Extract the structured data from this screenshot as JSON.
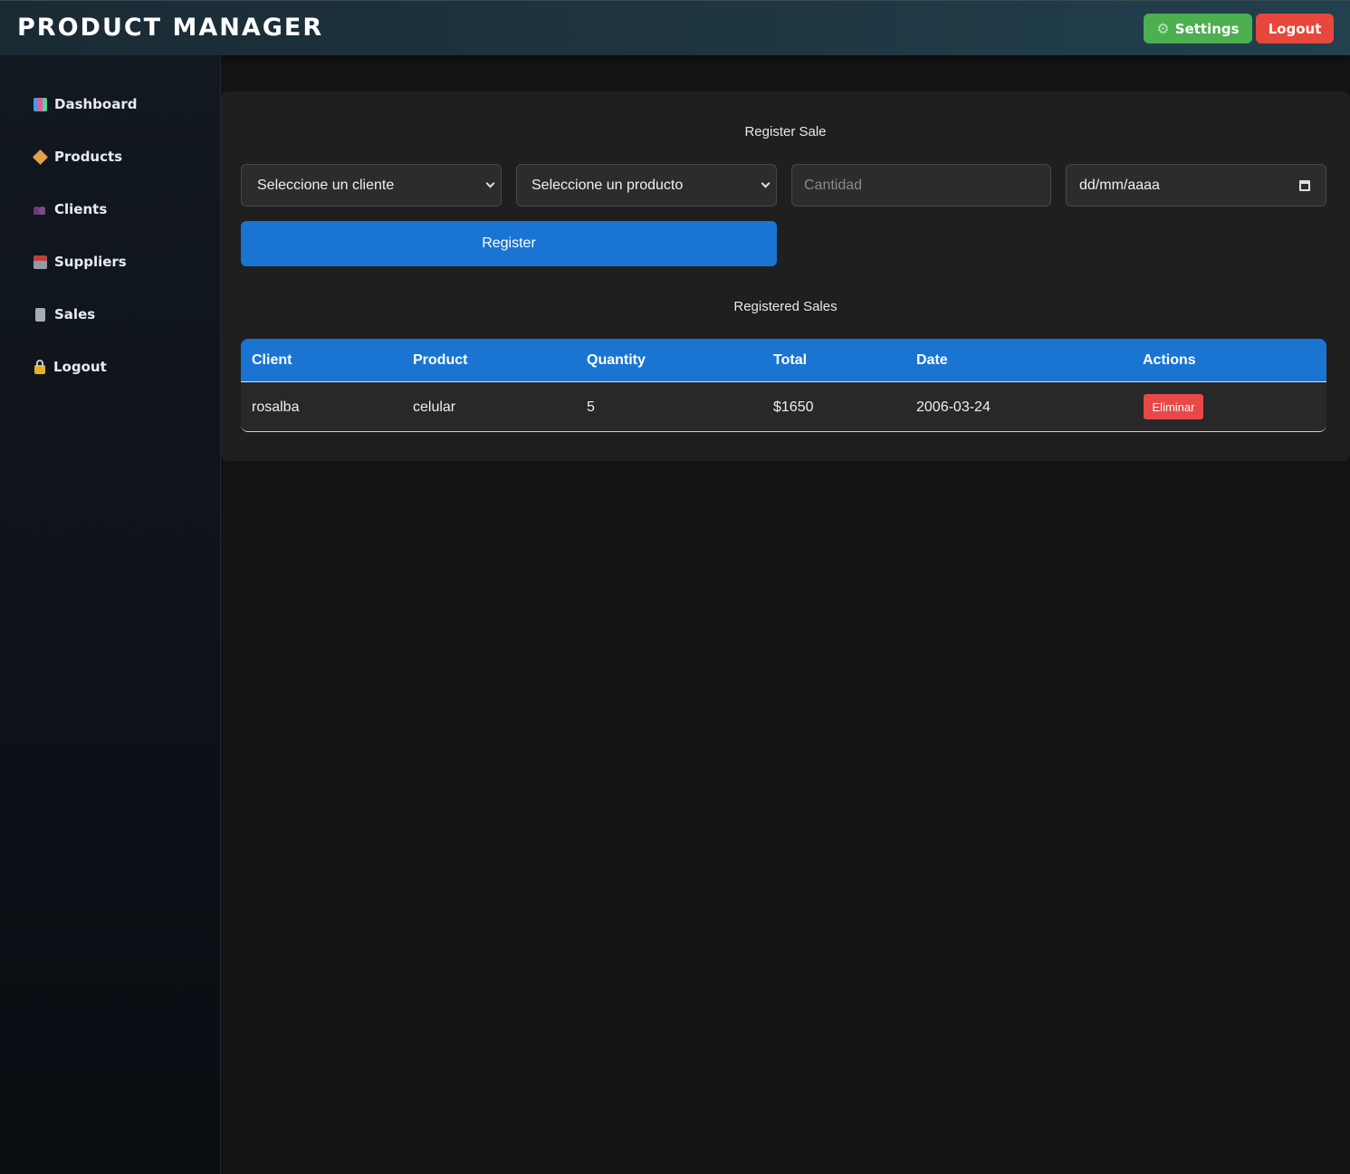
{
  "header": {
    "title": "PRODUCT MANAGER",
    "settings_label": "Settings",
    "logout_label": "Logout"
  },
  "sidebar": {
    "items": [
      {
        "label": "Dashboard",
        "icon": "chart-icon"
      },
      {
        "label": "Products",
        "icon": "package-icon"
      },
      {
        "label": "Clients",
        "icon": "people-icon"
      },
      {
        "label": "Suppliers",
        "icon": "factory-icon"
      },
      {
        "label": "Sales",
        "icon": "receipt-icon"
      },
      {
        "label": "Logout",
        "icon": "lock-icon"
      }
    ]
  },
  "form": {
    "title": "Register Sale",
    "client_select": "Seleccione un cliente",
    "product_select": "Seleccione un producto",
    "quantity_placeholder": "Cantidad",
    "date_placeholder": "dd/mm/aaaa",
    "register_label": "Register"
  },
  "sales": {
    "title": "Registered Sales",
    "columns": [
      "Client",
      "Product",
      "Quantity",
      "Total",
      "Date",
      "Actions"
    ],
    "rows": [
      {
        "client": "rosalba",
        "product": "celular",
        "quantity": "5",
        "total": "$1650",
        "date": "2006-03-24",
        "action": "Eliminar"
      }
    ]
  },
  "colors": {
    "accent": "#1a74d2",
    "settings": "#4caf50",
    "danger": "#e8473c"
  }
}
